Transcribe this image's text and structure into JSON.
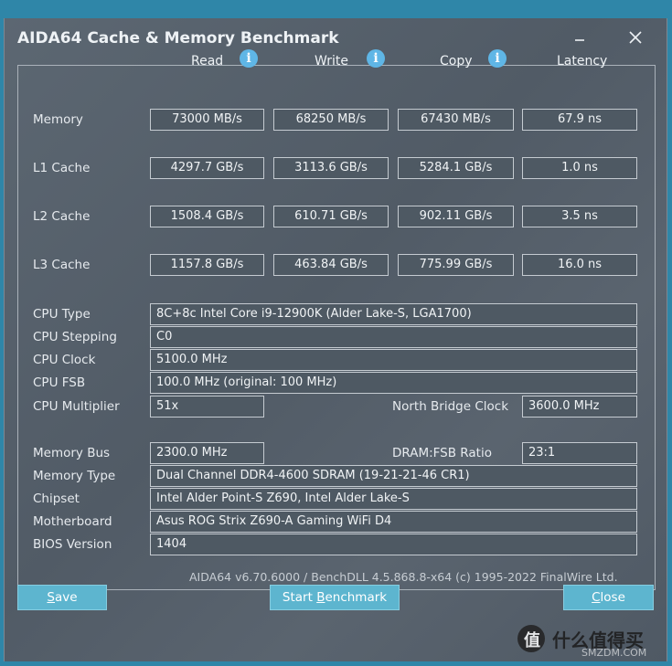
{
  "window": {
    "title": "AIDA64 Cache & Memory Benchmark"
  },
  "columns": [
    "Read",
    "Write",
    "Copy",
    "Latency"
  ],
  "bench_rows": [
    {
      "label": "Memory",
      "read": "73000 MB/s",
      "write": "68250 MB/s",
      "copy": "67430 MB/s",
      "latency": "67.9 ns"
    },
    {
      "label": "L1 Cache",
      "read": "4297.7 GB/s",
      "write": "3113.6 GB/s",
      "copy": "5284.1 GB/s",
      "latency": "1.0 ns"
    },
    {
      "label": "L2 Cache",
      "read": "1508.4 GB/s",
      "write": "610.71 GB/s",
      "copy": "902.11 GB/s",
      "latency": "3.5 ns"
    },
    {
      "label": "L3 Cache",
      "read": "1157.8 GB/s",
      "write": "463.84 GB/s",
      "copy": "775.99 GB/s",
      "latency": "16.0 ns"
    }
  ],
  "cpu": {
    "type_label": "CPU Type",
    "type_value": "8C+8c Intel Core i9-12900K  (Alder Lake-S, LGA1700)",
    "stepping_label": "CPU Stepping",
    "stepping_value": "C0",
    "clock_label": "CPU Clock",
    "clock_value": "5100.0 MHz",
    "fsb_label": "CPU FSB",
    "fsb_value": "100.0 MHz  (original: 100 MHz)",
    "multiplier_label": "CPU Multiplier",
    "multiplier_value": "51x",
    "nb_clock_label": "North Bridge Clock",
    "nb_clock_value": "3600.0 MHz"
  },
  "memory": {
    "bus_label": "Memory Bus",
    "bus_value": "2300.0 MHz",
    "ratio_label": "DRAM:FSB Ratio",
    "ratio_value": "23:1",
    "type_label": "Memory Type",
    "type_value": "Dual Channel DDR4-4600 SDRAM  (19-21-21-46 CR1)",
    "chipset_label": "Chipset",
    "chipset_value": "Intel Alder Point-S Z690, Intel Alder Lake-S",
    "motherboard_label": "Motherboard",
    "motherboard_value": "Asus ROG Strix Z690-A Gaming WiFi D4",
    "bios_label": "BIOS Version",
    "bios_value": "1404"
  },
  "footer": "AIDA64 v6.70.6000 / BenchDLL 4.5.868.8-x64  (c) 1995-2022 FinalWire Ltd.",
  "buttons": {
    "save_first": "S",
    "save_rest": "ave",
    "start_pre": "Start ",
    "start_u": "B",
    "start_post": "enchmark",
    "close_first": "C",
    "close_rest": "lose"
  },
  "watermark": {
    "text": "什么值得买",
    "sub": "SMZDM.COM"
  }
}
